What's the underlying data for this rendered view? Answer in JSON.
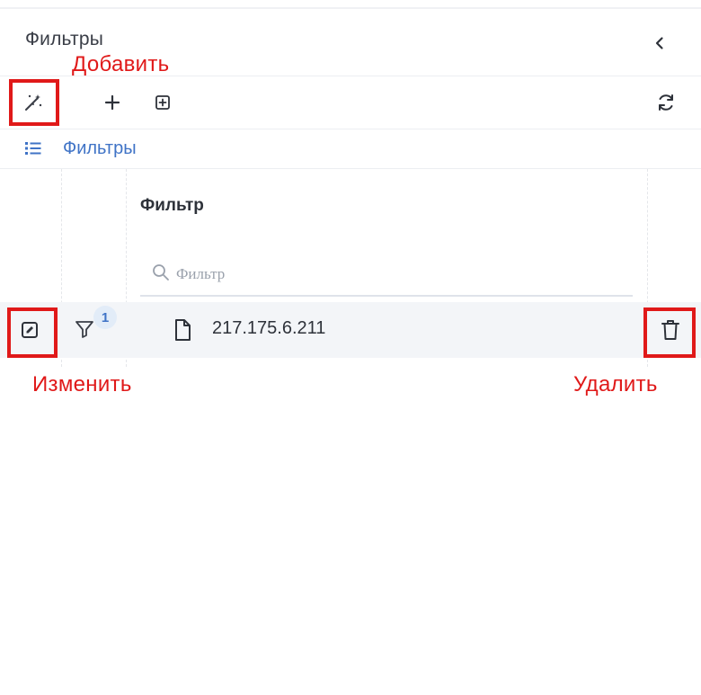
{
  "panel": {
    "title": "Фильтры"
  },
  "annotations": {
    "add": "Добавить",
    "edit": "Изменить",
    "delete": "Удалить",
    "highlight_color": "#e01919"
  },
  "toolbar": {
    "buttons": [
      {
        "icon": "magic-wand-icon"
      },
      {
        "icon": "plus-icon"
      },
      {
        "icon": "add-box-icon"
      },
      {
        "icon": "refresh-icon"
      }
    ]
  },
  "breadcrumb": {
    "icon": "list-icon",
    "label": "Фильтры",
    "color": "#3f73c6"
  },
  "table": {
    "column_header": "Фильтр",
    "filter_placeholder": "Фильтр",
    "rows": [
      {
        "filter_count": "1",
        "value": "217.175.6.211"
      }
    ]
  }
}
